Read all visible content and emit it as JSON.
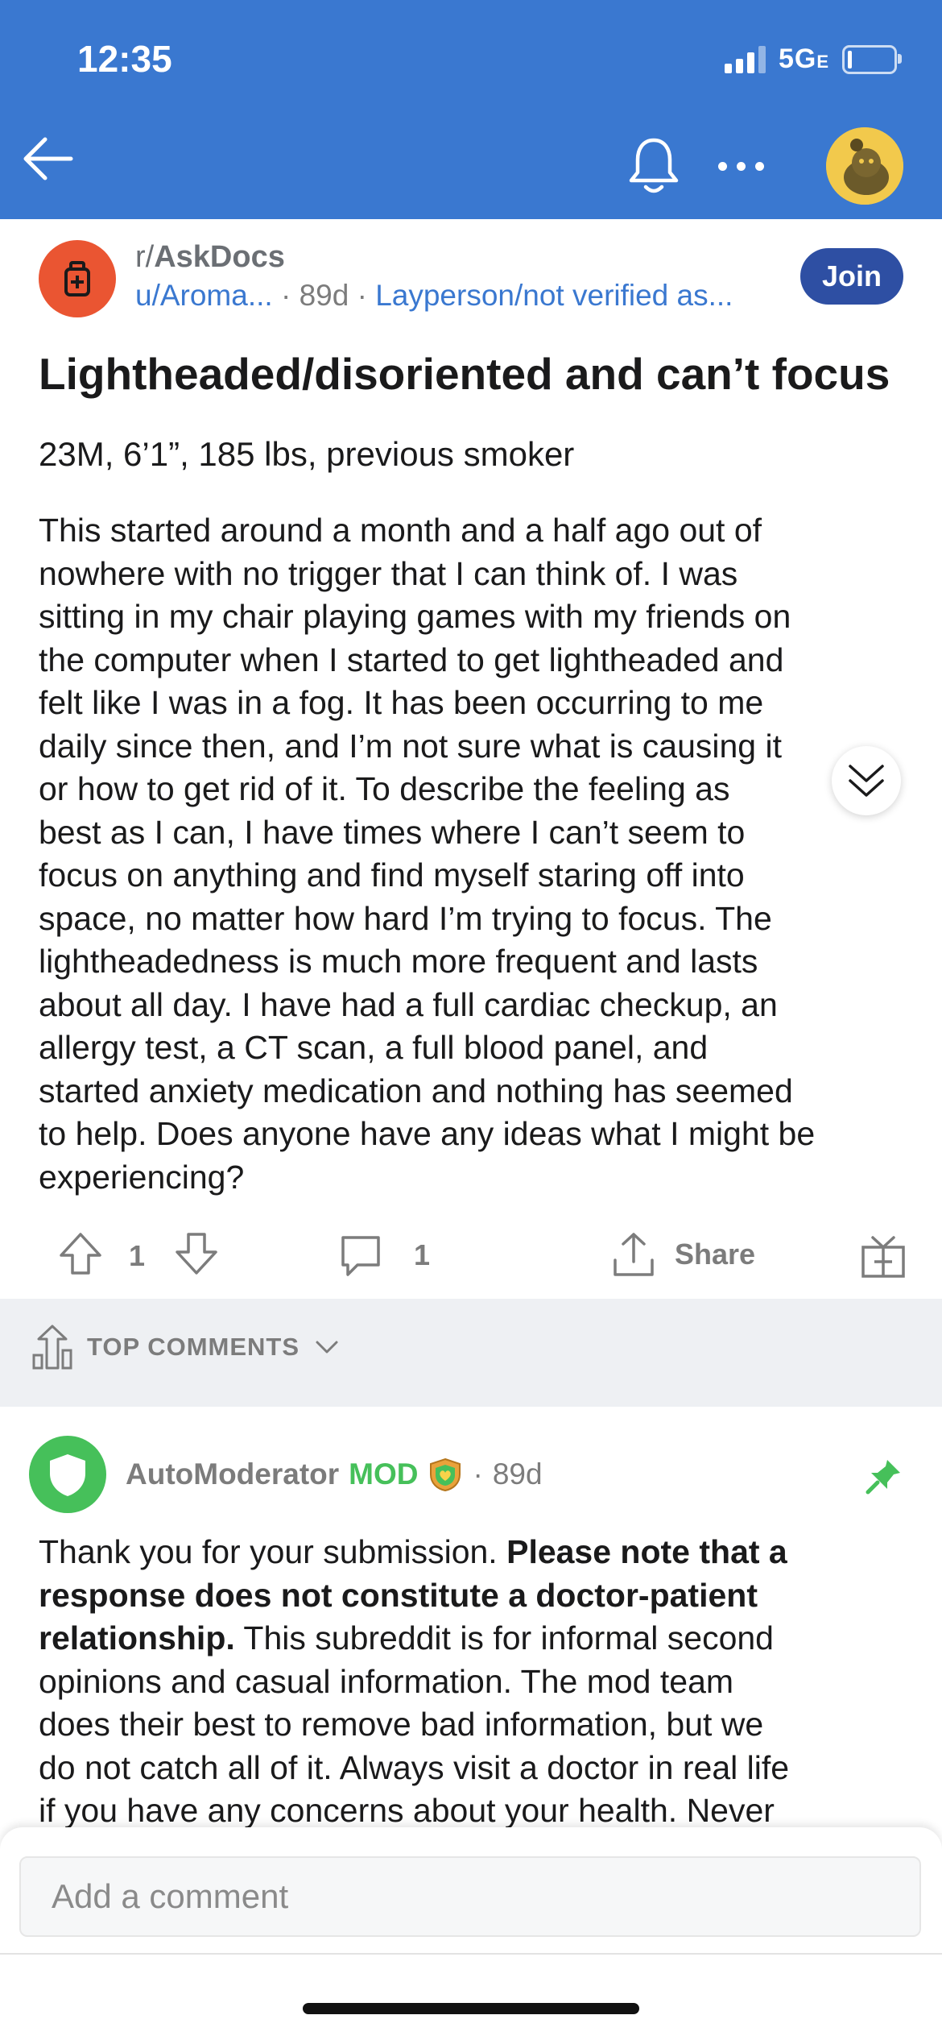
{
  "status_bar": {
    "time": "12:35",
    "network": "5G",
    "network_suffix": "E"
  },
  "header": {
    "back_icon": "arrow-left-icon",
    "bell_icon": "bell-icon",
    "more_icon": "more-horizontal-icon",
    "avatar_icon": "snoo-avatar-icon"
  },
  "post": {
    "subreddit": "AskDocs",
    "subreddit_prefix": "r/",
    "author": "u/Aroma...",
    "age": "89d",
    "flair": "Layperson/not verified as...",
    "join_label": "Join",
    "title": "Lightheaded/disoriented and can’t focus",
    "stats_line": "23M, 6’1”, 185 lbs, previous smoker",
    "body_lines": [
      "This started around a month and a half ago out of",
      "nowhere with no trigger that I can think of. I was",
      "sitting in my chair playing games with my friends on",
      "the computer when I started to get lightheaded and",
      "felt like I was in a fog. It has been occurring to me",
      "daily since then, and I’m not sure what is causing it",
      "or how to get rid of it. To describe the feeling as",
      "best as I can, I have times where I can’t seem to",
      "focus on anything and find myself staring off into",
      "space, no matter how hard I’m trying to focus. The",
      "lightheadedness is much more frequent and lasts",
      "about all day. I have had a full cardiac checkup, an",
      "allergy test, a CT scan, a full blood panel, and",
      "started anxiety medication and nothing has seemed",
      "to help. Does anyone have any ideas what I might be",
      "experiencing?"
    ],
    "vote_count": "1",
    "comment_count": "1",
    "share_label": "Share"
  },
  "comments_sort": {
    "label": "TOP COMMENTS"
  },
  "comment": {
    "author": "AutoModerator",
    "mod_badge": "MOD",
    "age": "89d",
    "body_lines": [
      {
        "plain": "Thank you for your submission. ",
        "bold": "Please note that a"
      },
      {
        "plain": "",
        "bold": "response does not constitute a doctor-patient"
      },
      {
        "plain": " This subreddit is for informal second",
        "bold": "relationship.",
        "bold_first": true
      },
      {
        "plain": "opinions and casual information. The mod team",
        "bold": ""
      },
      {
        "plain": "does their best to remove bad information, but we",
        "bold": ""
      },
      {
        "plain": "do not catch all of it. Always visit a doctor in real life",
        "bold": ""
      },
      {
        "plain": "if you have any concerns about your health. Never",
        "bold": ""
      }
    ]
  },
  "composer": {
    "placeholder": "Add a comment"
  },
  "colors": {
    "header_bg": "#3a78d0",
    "join_bg": "#2e4fa3",
    "subreddit_icon_bg": "#ea5532",
    "mod_green": "#46c05a"
  }
}
